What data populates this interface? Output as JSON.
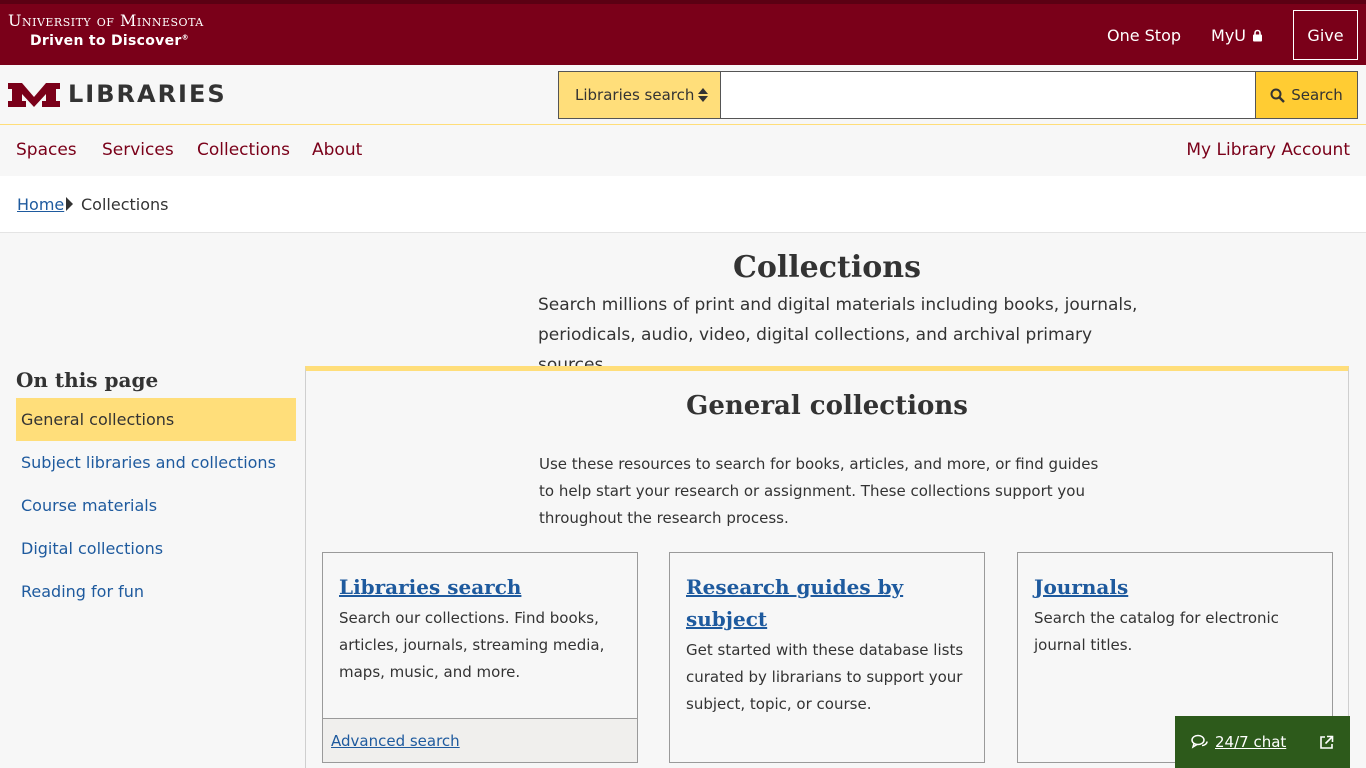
{
  "umn": {
    "name": "University of Minnesota",
    "tagline": "Driven to Discover",
    "links": [
      {
        "label": "One Stop"
      },
      {
        "label": "MyU"
      }
    ],
    "give_label": "Give"
  },
  "libraries": {
    "logo_text": "LIBRARIES",
    "search": {
      "scope": "Libraries search",
      "placeholder": "",
      "button_label": "Search"
    }
  },
  "nav": {
    "items": [
      "Spaces",
      "Services",
      "Collections",
      "About"
    ],
    "account_label": "My Library Account"
  },
  "breadcrumb": {
    "home": "Home",
    "current": "Collections"
  },
  "page": {
    "title": "Collections",
    "intro": "Search millions of print and digital materials including books, journals, periodicals, audio, video, digital collections, and archival primary sources."
  },
  "sidebar": {
    "title": "On this page",
    "items": [
      {
        "label": "General collections",
        "active": true
      },
      {
        "label": "Subject libraries and collections"
      },
      {
        "label": "Course materials"
      },
      {
        "label": "Digital collections"
      },
      {
        "label": "Reading for fun"
      }
    ]
  },
  "general": {
    "title": "General collections",
    "intro": "Use these resources to search for books, articles, and more, or find guides to help start your research or assignment. These collections support you throughout the research process.",
    "cards": [
      {
        "title": "Libraries search",
        "text": "Search our collections. Find books, articles, journals, streaming media, maps, music, and more.",
        "footer_link": "Advanced search"
      },
      {
        "title": "Research guides by subject",
        "text": "Get started with these database lists curated by librarians to support your subject, topic, or course."
      },
      {
        "title": "Journals",
        "text": "Search the catalog for electronic journal titles."
      }
    ]
  },
  "chat": {
    "label": "24/7 chat"
  },
  "colors": {
    "maroon": "#7a0019",
    "gold": "#ffde7a",
    "gold_button": "#ffcc33",
    "link_blue": "#1e5a9e",
    "chat_green": "#2d5a1b"
  }
}
